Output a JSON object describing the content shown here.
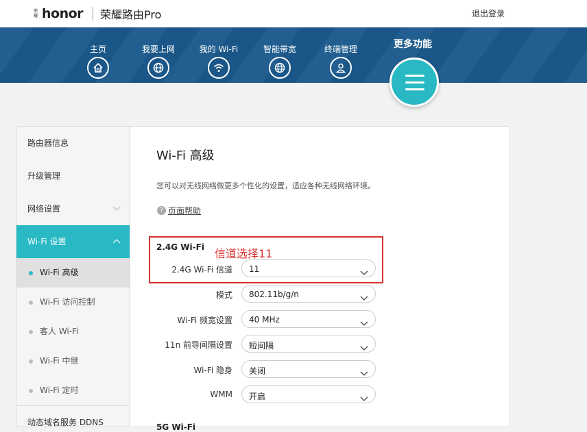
{
  "header": {
    "logo_small": "荣耀",
    "logo_word": "honor",
    "product_name": "荣耀路由Pro",
    "logout": "退出登录"
  },
  "nav": {
    "items": [
      {
        "label": "主页",
        "icon": "home-icon"
      },
      {
        "label": "我要上网",
        "icon": "globe-icon"
      },
      {
        "label": "我的 Wi-Fi",
        "icon": "wifi-icon"
      },
      {
        "label": "智能带宽",
        "icon": "bandwidth-globe-icon"
      },
      {
        "label": "终端管理",
        "icon": "user-icon"
      }
    ],
    "more_label": "更多功能",
    "more_icon": "menu-icon"
  },
  "sidebar": {
    "items": [
      {
        "label": "路由器信息"
      },
      {
        "label": "升级管理"
      },
      {
        "label": "网络设置"
      },
      {
        "label": "Wi-Fi 设置"
      }
    ],
    "subitems": [
      {
        "label": "Wi-Fi 高级"
      },
      {
        "label": "Wi-Fi 访问控制"
      },
      {
        "label": "客人 Wi-Fi"
      },
      {
        "label": "Wi-Fi 中继"
      },
      {
        "label": "Wi-Fi 定时"
      }
    ],
    "last_item": "动态域名服务 DDNS"
  },
  "main": {
    "title": "Wi-Fi 高级",
    "description": "您可以对无线网络做更多个性化的设置，适应各种无线网络环境。",
    "help_label": "页面帮助",
    "section_24g": "2.4G Wi-Fi",
    "annotation": "信道选择11",
    "annotation_color": "#d9302c",
    "accent_color": "#28b9c4",
    "fields": [
      {
        "label": "2.4G Wi-Fi 信道",
        "value": "11"
      },
      {
        "label": "模式",
        "value": "802.11b/g/n"
      },
      {
        "label": "Wi-Fi 频宽设置",
        "value": "40 MHz"
      },
      {
        "label": "11n 前导间隔设置",
        "value": "短间隔"
      },
      {
        "label": "Wi-Fi 隐身",
        "value": "关闭"
      },
      {
        "label": "WMM",
        "value": "开启"
      }
    ],
    "section_5g": "5G Wi-Fi"
  }
}
